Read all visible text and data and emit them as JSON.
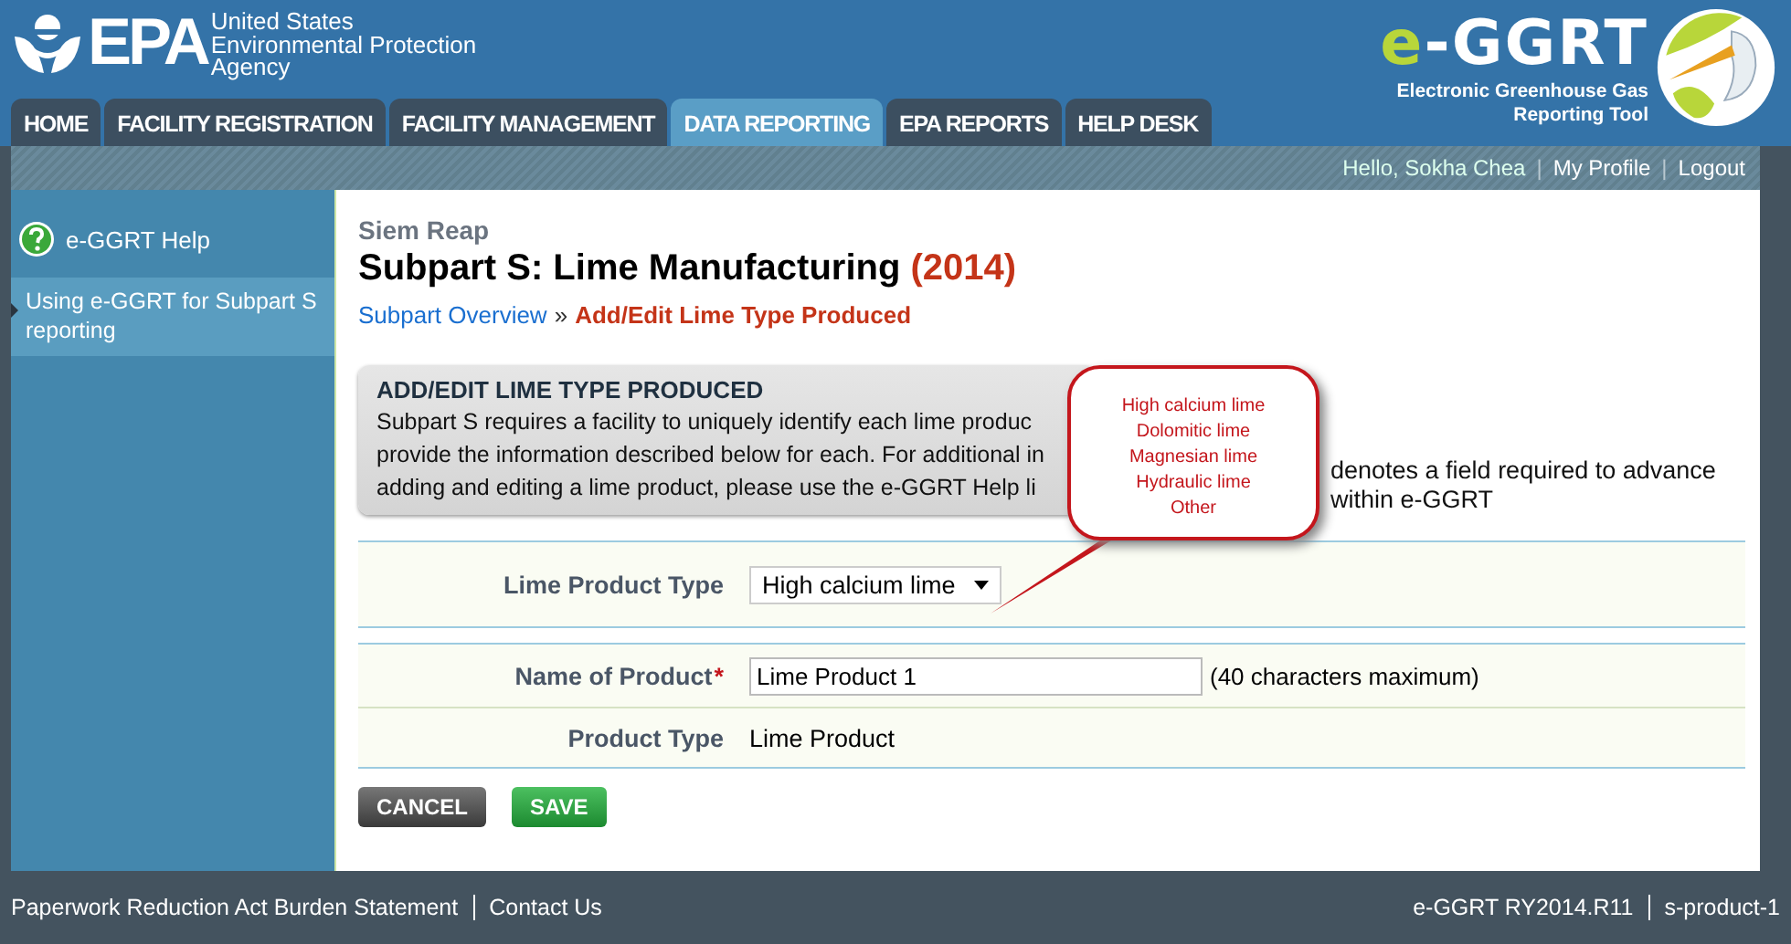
{
  "header": {
    "agency_logo": {
      "letters": "EPA",
      "lines": [
        "United States",
        "Environmental Protection",
        "Agency"
      ]
    },
    "tool_logo": {
      "prefix": "e",
      "name": "-GGRT",
      "subtitle": [
        "Electronic Greenhouse Gas",
        "Reporting Tool"
      ]
    }
  },
  "tabs": [
    {
      "label": "HOME",
      "selected": false
    },
    {
      "label": "FACILITY REGISTRATION",
      "selected": false
    },
    {
      "label": "FACILITY MANAGEMENT",
      "selected": false
    },
    {
      "label": "DATA REPORTING",
      "selected": true
    },
    {
      "label": "EPA REPORTS",
      "selected": false
    },
    {
      "label": "HELP DESK",
      "selected": false
    }
  ],
  "user_bar": {
    "greeting": "Hello, Sokha Chea",
    "separator": "|",
    "links": [
      "My Profile",
      "Logout"
    ]
  },
  "sidebar": {
    "help_title": "e-GGRT Help",
    "items": [
      {
        "label": "Using e-GGRT for Subpart S reporting",
        "selected": true
      }
    ]
  },
  "page": {
    "facility": "Siem Reap",
    "title": "Subpart S: Lime Manufacturing",
    "year": "(2014)",
    "breadcrumb": [
      {
        "label": "Subpart Overview",
        "kind": "link"
      },
      {
        "label": "»",
        "kind": "separator"
      },
      {
        "label": "Add/Edit Lime Type Produced",
        "kind": "current"
      }
    ]
  },
  "intro": {
    "heading": "ADD/EDIT LIME TYPE PRODUCED",
    "lines": [
      "Subpart S requires a facility to uniquely identify each lime produc",
      "provide the information described below for each. For additional in",
      "adding and editing a lime product, please use the e-GGRT Help li"
    ],
    "required_note": [
      "denotes a field required to advance",
      "within e-GGRT"
    ]
  },
  "callout": {
    "options": [
      "High calcium lime",
      "Dolomitic lime",
      "Magnesian lime",
      "Hydraulic lime",
      "Other"
    ]
  },
  "form": {
    "rows": [
      {
        "kind": "select",
        "label": "Lime Product Type",
        "value": "High calcium lime"
      },
      {
        "kind": "input",
        "label": "Name of Product",
        "required": true,
        "required_mark": "*",
        "value": "Lime Product 1",
        "hint": "(40 characters maximum)"
      },
      {
        "kind": "text",
        "label": "Product Type",
        "value": "Lime Product"
      }
    ]
  },
  "buttons": [
    {
      "label": "CANCEL",
      "kind": "cancel"
    },
    {
      "label": "SAVE",
      "kind": "save"
    }
  ],
  "footer": {
    "left": [
      "Paperwork Reduction Act Burden Statement",
      "Contact Us"
    ],
    "right": [
      "e-GGRT RY2014.R11",
      "s-product-1"
    ]
  }
}
